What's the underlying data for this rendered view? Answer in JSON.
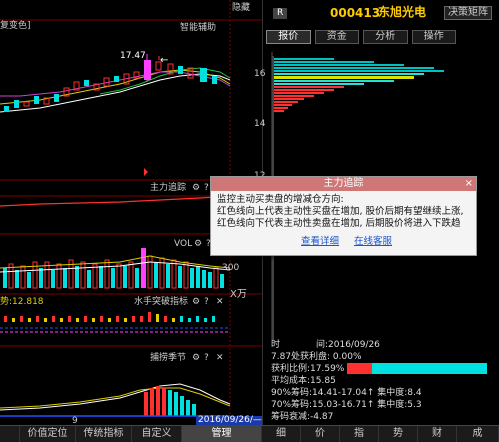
{
  "left": {
    "top_label_left": "复变色]",
    "hide_btn": "隐藏",
    "smart_assist": "智能辅助",
    "price_marker": "17.47",
    "main_tracking": "主力追踪",
    "vol_label": "VOL",
    "vol_right_val": "300",
    "vol_unit": "X万",
    "trend_label": "势:12.818",
    "water_label": "水手突破指标",
    "catch_label": "捕捞季节",
    "date_label": "2016/09/26/—",
    "x_tick": "9"
  },
  "right": {
    "badge": "R",
    "stock_code": "000413",
    "stock_name": "东旭光电",
    "decision_btn": "决策矩阵",
    "tabs": [
      {
        "label": "报价",
        "active": true
      },
      {
        "label": "资金",
        "active": false
      },
      {
        "label": "分析",
        "active": false
      },
      {
        "label": "操作",
        "active": false
      }
    ],
    "axis_16": "16",
    "axis_14": "14",
    "axis_12": "12",
    "time_label": "时",
    "time_value": "间:2016/09/26",
    "profit_label": "7.87处获利盘: 0.00%",
    "profit_ratio_label": "获利比例:17.59%",
    "avg_cost": "平均成本:15.85",
    "chip90": "90%筹码:14.41-17.04↑ 集中度:8.4",
    "chip70": "70%筹码:15.03-16.71↑ 集中度:5.3",
    "chip_decay": "筹码衰减:-4.87",
    "profit_ratio_value": 0.1759
  },
  "popup": {
    "title": "主力追踪",
    "close": "×",
    "line1": "监控主动买卖盘的增减仓方向:",
    "line2": "红色线向上代表主动性买盘在增加, 股价后期有望继续上涨,",
    "line3": "红色线向下代表主动性卖盘在增加, 后期股价将进入下跌趋",
    "link1": "查看详细",
    "link2": "在线客服"
  },
  "bottom": {
    "left_buttons": [
      "",
      "价值定位",
      "传统指标",
      "自定义",
      "管理"
    ],
    "right_buttons": [
      "细",
      "价",
      "指",
      "势",
      "财",
      "成"
    ]
  }
}
